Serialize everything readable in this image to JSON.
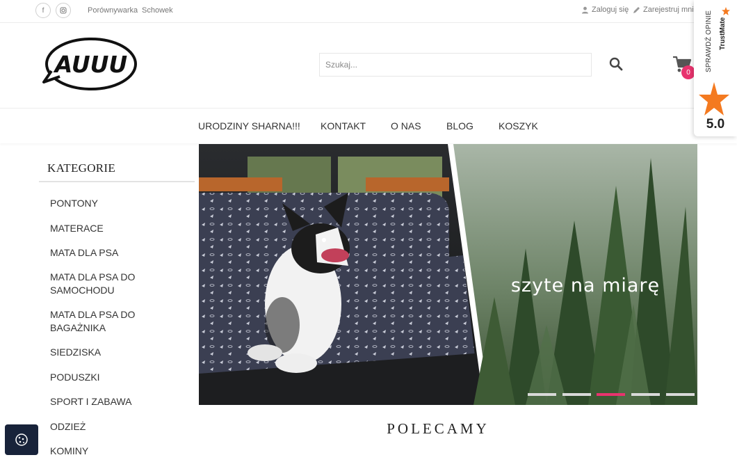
{
  "topbar": {
    "facebook": "f",
    "instagram_icon": "instagram-icon",
    "links": [
      "Porównywarka",
      "Schowek"
    ],
    "login": "Zaloguj się",
    "register": "Zarejestruj mnie"
  },
  "header": {
    "logo_text": "AUUU",
    "search_placeholder": "Szukaj...",
    "cart_count": "0"
  },
  "nav": [
    "URODZINY SHARNA!!!",
    "KONTAKT",
    "O NAS",
    "BLOG",
    "KOSZYK"
  ],
  "sidebar": {
    "title": "KATEGORIE",
    "items": [
      "PONTONY",
      "MATERACE",
      "MATA DLA PSA",
      "MATA DLA PSA DO SAMOCHODU",
      "MATA DLA PSA DO BAGAŻNIKA",
      "SIEDZISKA",
      "PODUSZKI",
      "SPORT I ZABAWA",
      "ODZIEŻ",
      "KOMINY"
    ]
  },
  "hero": {
    "slogan": "szyte na miarę",
    "slide_count": 5,
    "active_slide": 3
  },
  "section_title": "POLECAMY",
  "trustmate": {
    "label": "SPRAWDŹ OPINIE",
    "brand": "TrustMate",
    "score": "5.0"
  },
  "colors": {
    "accent": "#e8336e",
    "star": "#f47a20",
    "cookie_bg": "#18233a"
  }
}
